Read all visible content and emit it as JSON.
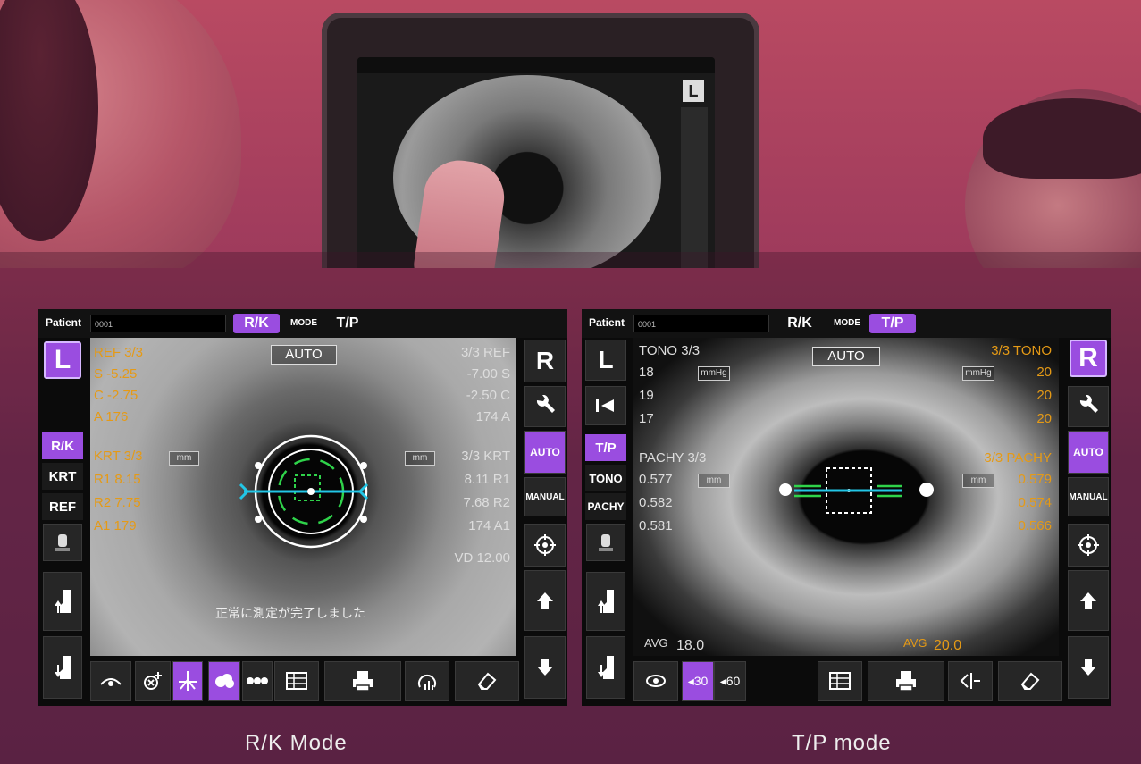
{
  "captions": {
    "left": "R/K Mode",
    "right": "T/P mode"
  },
  "common": {
    "patient_label": "Patient",
    "patient_value": "0001",
    "tab_rk": "R/K",
    "tab_mode": "MODE",
    "tab_tp": "T/P",
    "auto": "AUTO",
    "manual": "MANUAL"
  },
  "rk": {
    "left_eye_button": "L",
    "right_eye_button": "R",
    "mode_buttons": [
      "R/K",
      "KRT",
      "REF"
    ],
    "ref_left": {
      "header": "REF 3/3",
      "s": "S -5.25",
      "c": "C -2.75",
      "a": "A 176"
    },
    "ref_right": {
      "header": "3/3 REF",
      "s": "-7.00 S",
      "c": "-2.50 C",
      "a": "174 A"
    },
    "krt_left": {
      "header": "KRT 3/3",
      "unit": "mm",
      "r1": "R1 8.15",
      "r2": "R2 7.75",
      "a1": "A1 179"
    },
    "krt_right": {
      "header": "3/3 KRT",
      "unit": "mm",
      "r1": "8.11 R1",
      "r2": "7.68 R2",
      "a1": "174 A1"
    },
    "vd": "VD 12.00",
    "message": "正常に測定が完了しました"
  },
  "tp": {
    "left_eye_button": "L",
    "right_eye_button": "R",
    "mode_buttons": [
      "T/P",
      "TONO",
      "PACHY"
    ],
    "tono_left": {
      "header": "TONO 3/3",
      "unit": "mmHg",
      "values": [
        "18",
        "19",
        "17"
      ]
    },
    "tono_right": {
      "header": "3/3 TONO",
      "unit": "mmHg",
      "values": [
        "20",
        "20",
        "20"
      ]
    },
    "pachy_left": {
      "header": "PACHY 3/3",
      "unit": "mm",
      "values": [
        "0.577",
        "0.582",
        "0.581"
      ]
    },
    "pachy_right": {
      "header": "3/3 PACHY",
      "unit": "mm",
      "values": [
        "0.579",
        "0.574",
        "0.566"
      ]
    },
    "avg_left_label": "AVG",
    "avg_left_value": "18.0",
    "avg_right_label": "AVG",
    "avg_right_value": "20.0",
    "seg_30": "30",
    "seg_60": "60"
  },
  "colors": {
    "accent": "#9a4de0",
    "overlay_orange": "#e59a16",
    "reticle_cyan": "#22c6e6",
    "reticle_green": "#2fd34a"
  }
}
